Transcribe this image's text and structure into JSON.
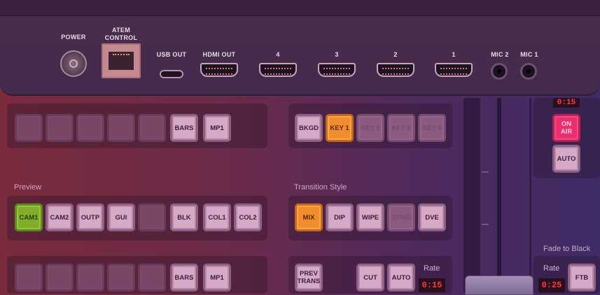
{
  "connectors": {
    "power": "POWER",
    "atem_control": "ATEM\nCONTROL",
    "usb_out": "USB OUT",
    "hdmi_out": "HDMI OUT",
    "hdmi_inputs": [
      "4",
      "3",
      "2",
      "1"
    ],
    "mic2": "MIC 2",
    "mic1": "MIC 1"
  },
  "program_row": {
    "buttons": [
      "",
      "",
      "",
      "",
      "",
      "BARS",
      "MP1"
    ]
  },
  "keyers_row": {
    "buttons": [
      "BKGD",
      "KEY 1",
      "KEY 2",
      "KEY 3",
      "KEY 4"
    ],
    "active": "KEY 1"
  },
  "preview": {
    "label": "Preview",
    "buttons": [
      "CAM1",
      "CAM2",
      "OUTP",
      "GUI",
      "",
      "BLK",
      "COL1",
      "COL2"
    ],
    "active": "CAM1"
  },
  "transition_style": {
    "label": "Transition Style",
    "buttons": [
      "MIX",
      "DIP",
      "WIPE",
      "STING",
      "DVE"
    ],
    "active": "MIX"
  },
  "bottom_row": {
    "buttons": [
      "",
      "",
      "",
      "",
      "",
      "BARS",
      "MP1"
    ]
  },
  "transition_controls": {
    "prev_trans": "PREV\nTRANS",
    "cut": "CUT",
    "auto": "AUTO",
    "rate_label": "Rate",
    "rate_value": "0:15"
  },
  "downstream": {
    "rate_value_top": "0:15",
    "on_air": "ON\nAIR",
    "auto": "AUTO"
  },
  "fade_to_black": {
    "label": "Fade to Black",
    "rate_label": "Rate",
    "rate_value": "0:25",
    "button": "FTB"
  },
  "colors": {
    "active_green": "#7fae2a",
    "active_orange": "#f08d2f",
    "on_air_red": "#ea2e6e",
    "rate_red": "#ff3a3a"
  }
}
